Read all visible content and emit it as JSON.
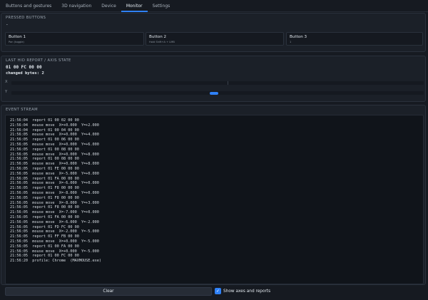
{
  "tabs": [
    {
      "label": "Buttons and gestures"
    },
    {
      "label": "3D navigation"
    },
    {
      "label": "Device"
    },
    {
      "label": "Monitor",
      "active": true
    },
    {
      "label": "Settings"
    }
  ],
  "pressed": {
    "title": "PRESSED BUTTONS",
    "value": "-",
    "buttons": [
      {
        "label": "Button 1",
        "sub": "Pan (toggle)"
      },
      {
        "label": "Button 2",
        "sub": "Hold Shift+A + LMB"
      },
      {
        "label": "Button 3",
        "sub": "1"
      }
    ]
  },
  "report": {
    "title": "LAST HID REPORT / AXIS STATE",
    "bytes": "01 00 FC 00 00",
    "changed": "changed bytes: 2",
    "axes": [
      {
        "label": "X",
        "value": 0
      },
      {
        "label": "Y",
        "value": -5
      }
    ]
  },
  "stream": {
    "title": "EVENT STREAM",
    "lines": [
      "21:56:04  report 01 00 02 00 00",
      "21:56:04  mouse move  X=+0.000  Y=+2.000",
      "21:56:04  report 01 00 04 00 00",
      "21:56:05  mouse move  X=+0.000  Y=+4.000",
      "21:56:05  report 01 00 06 00 00",
      "21:56:05  mouse move  X=+0.000  Y=+6.000",
      "21:56:05  report 01 00 08 00 00",
      "21:56:05  mouse move  X=+0.000  Y=+8.000",
      "21:56:05  report 01 00 08 00 00",
      "21:56:05  mouse move  X=+0.000  Y=+8.000",
      "21:56:05  report 01 FE 00 00 00",
      "21:56:05  mouse move  X=-5.000  Y=+0.000",
      "21:56:05  report 01 FA 00 00 00",
      "21:56:05  mouse move  X=-6.000  Y=+0.000",
      "21:56:05  report 01 F8 00 00 00",
      "21:56:05  mouse move  X=-8.000  Y=+0.000",
      "21:56:05  report 01 F8 00 00 00",
      "21:56:05  mouse move  X=-8.000  Y=+3.000",
      "21:56:05  report 01 F8 00 00 00",
      "21:56:05  mouse move  X=-7.000  Y=+0.000",
      "21:56:05  report 01 FA 00 00 00",
      "21:56:05  mouse move  X=-6.000  Y=-2.000",
      "21:56:05  report 01 FD FC 00 00",
      "21:56:05  mouse move  X=-2.000  Y=-5.000",
      "21:56:05  report 01 FF FB 00 00",
      "21:56:05  mouse move  X=+0.000  Y=-5.000",
      "21:56:05  report 01 00 FA 00 00",
      "21:56:05  mouse move  X=+0.000  Y=-5.000",
      "21:56:05  report 01 00 FC 00 00",
      "21:56:20  profile: Chrome  (MAXMOUSE.exe)"
    ]
  },
  "footer": {
    "clear_label": "Clear",
    "show_axes_label": "Show axes and reports",
    "show_axes_checked": true
  },
  "colors": {
    "accent": "#2f81f7",
    "background": "#161a21",
    "panel": "#1b2028"
  }
}
